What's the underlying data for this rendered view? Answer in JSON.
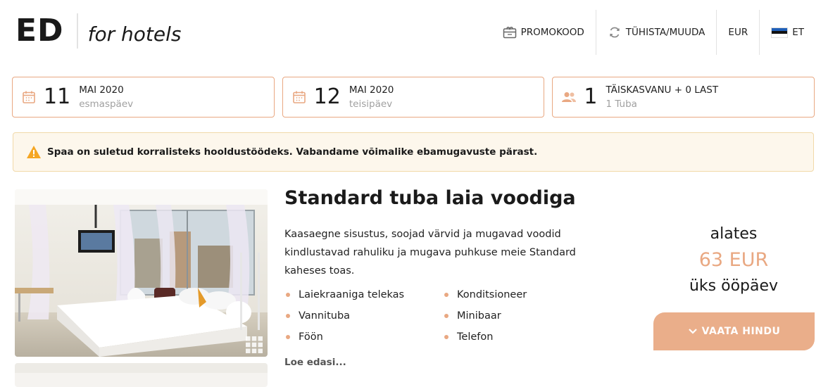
{
  "brand": {
    "logo_main": "ED",
    "logo_sub": "for hotels"
  },
  "topnav": {
    "promo_label": "PROMOKOOD",
    "cancel_label": "TÜHISTA/MUUDA",
    "currency_label": "EUR",
    "language_label": "ET"
  },
  "booking": {
    "checkin": {
      "day": "11",
      "month": "MAI 2020",
      "weekday": "esmaspäev"
    },
    "checkout": {
      "day": "12",
      "month": "MAI 2020",
      "weekday": "teisipäev"
    },
    "guests": {
      "count": "1",
      "label": "TÄISKASVANU + 0 LAST",
      "rooms": "1 Tuba"
    }
  },
  "alert": {
    "text": "Spaa on suletud korralisteks hooldustöödeks. Vabandame võimalike ebamugavuste pärast."
  },
  "room": {
    "title": "Standard tuba laia voodiga",
    "description": "Kaasaegne sisustus, soojad värvid ja mugavad voodid kindlustavad rahuliku ja mugava puhkuse meie Standard kaheses toas.",
    "amenities": [
      "Laiekraaniga telekas",
      "Konditsioneer",
      "Vannituba",
      "Minibaar",
      "Föön",
      "Telefon"
    ],
    "read_more": "Loe edasi...",
    "price_from": "alates",
    "price_value": "63 EUR",
    "price_per": "üks ööpäev",
    "price_button": "VAATA HINDU"
  },
  "colors": {
    "accent": "#e9a882",
    "button": "#eaae8a",
    "alert_bg": "#fdf7ec",
    "alert_border": "#f1d9a8",
    "warning": "#f5a623"
  },
  "icons": {
    "promo": "gift-card-icon",
    "cancel": "refresh-icon",
    "language": "estonian-flag-icon",
    "date": "calendar-icon",
    "guests": "people-icon",
    "alert": "warning-icon",
    "gallery": "grid-icon",
    "button": "chevron-down-icon"
  }
}
